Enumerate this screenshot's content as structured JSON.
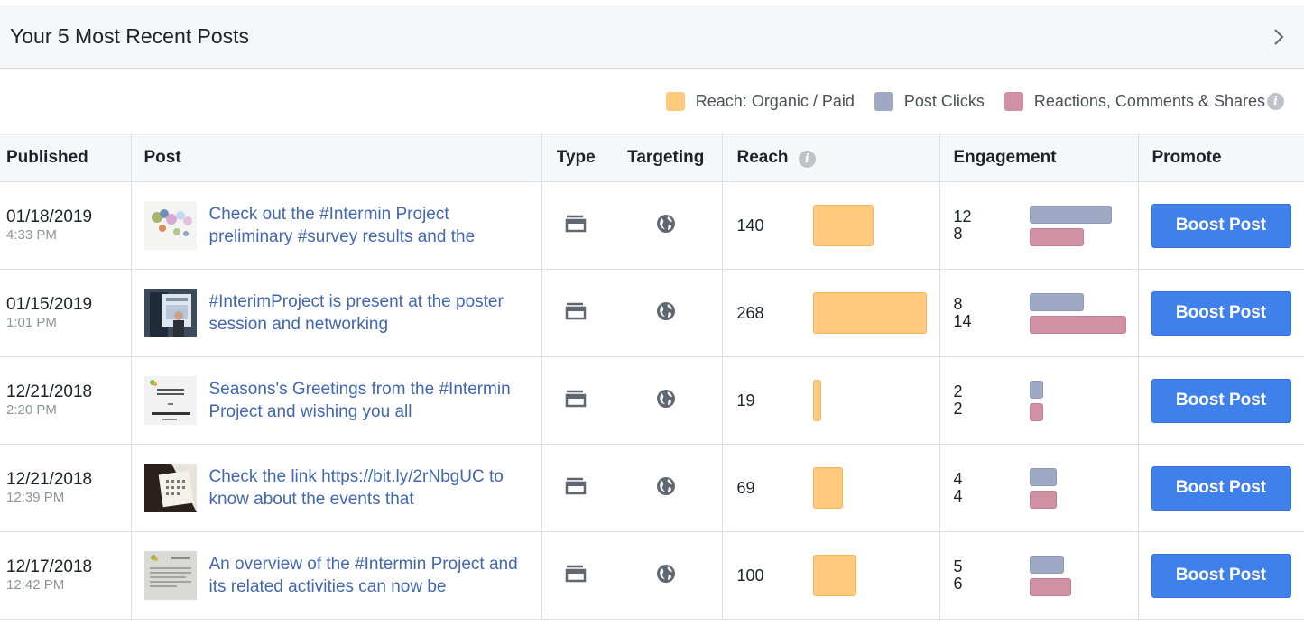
{
  "header": {
    "title": "Your 5 Most Recent Posts"
  },
  "legend": {
    "items": [
      {
        "label": "Reach: Organic / Paid",
        "color": "#ffc97e"
      },
      {
        "label": "Post Clicks",
        "color": "#9fa9c6"
      },
      {
        "label": "Reactions, Comments & Shares",
        "color": "#d191a5"
      }
    ]
  },
  "table": {
    "columns": {
      "published": "Published",
      "post": "Post",
      "type": "Type",
      "targeting": "Targeting",
      "reach": "Reach",
      "engagement": "Engagement",
      "promote": "Promote"
    },
    "rows": [
      {
        "date": "01/18/2019",
        "time": "4:33 PM",
        "text": "Check out the #Intermin Project preliminary #survey results and the",
        "reach": "140",
        "clicks": "12",
        "reactions": "8",
        "boost_label": "Boost Post"
      },
      {
        "date": "01/15/2019",
        "time": "1:01 PM",
        "text": "#InterimProject is present at the poster session and networking",
        "reach": "268",
        "clicks": "8",
        "reactions": "14",
        "boost_label": "Boost Post"
      },
      {
        "date": "12/21/2018",
        "time": "2:20 PM",
        "text": "Seasons's Greetings from the #Intermin Project and wishing you all",
        "reach": "19",
        "clicks": "2",
        "reactions": "2",
        "boost_label": "Boost Post"
      },
      {
        "date": "12/21/2018",
        "time": "12:39 PM",
        "text": "Check the link https://bit.ly/2rNbgUC to know about the events that",
        "reach": "69",
        "clicks": "4",
        "reactions": "4",
        "boost_label": "Boost Post"
      },
      {
        "date": "12/17/2018",
        "time": "12:42 PM",
        "text": "An overview of the #Intermin Project and its related activities can now be",
        "reach": "100",
        "clicks": "5",
        "reactions": "6",
        "boost_label": "Boost Post"
      }
    ]
  }
}
